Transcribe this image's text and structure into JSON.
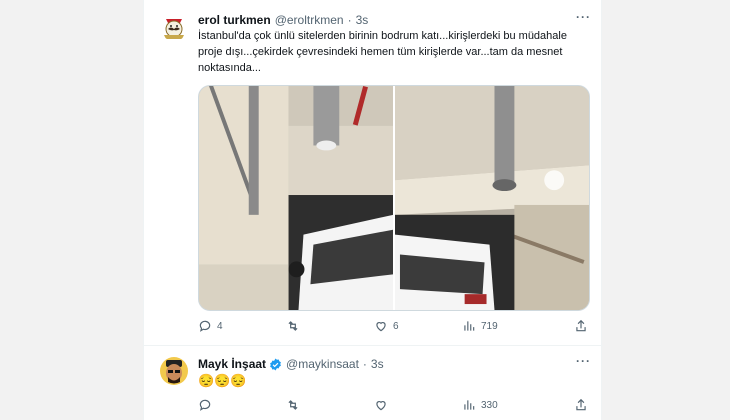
{
  "tweets": [
    {
      "name": "erol turkmen",
      "handle": "@eroltrkmen",
      "separator": "·",
      "time": "3s",
      "text": "İstanbul'da çok ünlü sitelerden birinin bodrum katı...kirişlerdeki bu müdahale proje dışı...çekirdek çevresindeki hemen tüm kirişlerde var...tam da mesnet noktasında...",
      "more": "···",
      "stats": {
        "replies": "4",
        "retweets": "",
        "likes": "6",
        "views": "719"
      },
      "avatar_icon": "moustache-emblem-avatar",
      "verified": false
    },
    {
      "name": "Mayk İnşaat",
      "handle": "@maykinsaat",
      "separator": "·",
      "time": "3s",
      "text": "😔😔😔",
      "more": "···",
      "stats": {
        "replies": "",
        "retweets": "",
        "likes": "",
        "views": "330"
      },
      "avatar_icon": "cartoon-face-avatar",
      "verified": true
    }
  ],
  "colors": {
    "muted": "#536471",
    "verified": "#1d9bf0",
    "border": "#eff3f4"
  }
}
